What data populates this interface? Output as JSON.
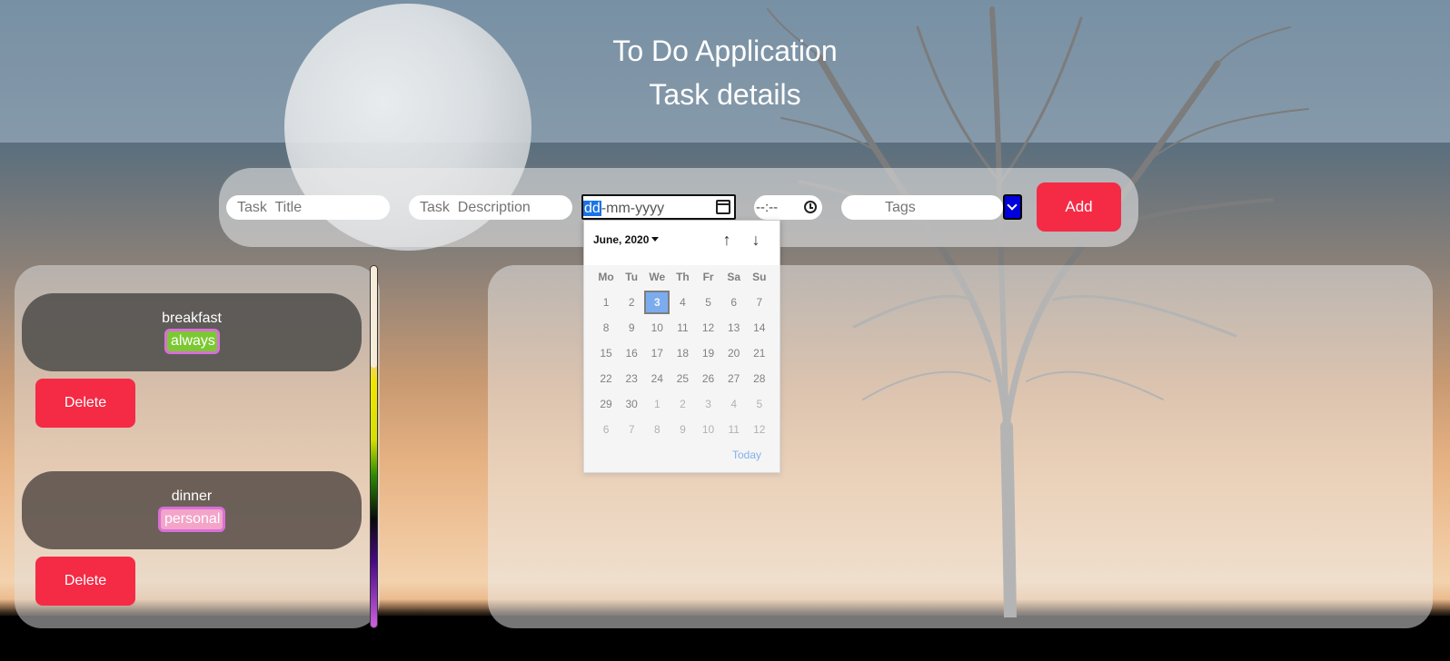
{
  "header": {
    "app_title": "To Do Application",
    "section_title": "Task details"
  },
  "form": {
    "title_placeholder": "Task  Title",
    "description_placeholder": "Task  Description",
    "date_value": {
      "day": "dd",
      "rest": "-mm-yyyy"
    },
    "time_value": "--:--",
    "tags_placeholder": "Tags",
    "add_label": "Add"
  },
  "calendar": {
    "month_label": "June, 2020",
    "weekdays": [
      "Mo",
      "Tu",
      "We",
      "Th",
      "Fr",
      "Sa",
      "Su"
    ],
    "weeks": [
      [
        "1",
        "2",
        "3",
        "4",
        "5",
        "6",
        "7"
      ],
      [
        "8",
        "9",
        "10",
        "11",
        "12",
        "13",
        "14"
      ],
      [
        "15",
        "16",
        "17",
        "18",
        "19",
        "20",
        "21"
      ],
      [
        "22",
        "23",
        "24",
        "25",
        "26",
        "27",
        "28"
      ],
      [
        "29",
        "30",
        "1",
        "2",
        "3",
        "4",
        "5"
      ],
      [
        "6",
        "7",
        "8",
        "9",
        "10",
        "11",
        "12"
      ]
    ],
    "selected_day": "3",
    "today_label": "Today"
  },
  "tasks": [
    {
      "name": "breakfast",
      "tag": "always",
      "tag_color": "#7cc832",
      "delete_label": "Delete"
    },
    {
      "name": "dinner",
      "tag": "personal",
      "tag_color": "#f3a4c8",
      "delete_label": "Delete"
    }
  ],
  "colors": {
    "accent_button": "#f52a45",
    "calendar_selected": "#0a6cf0",
    "tags_dropdown": "#0000dd"
  }
}
